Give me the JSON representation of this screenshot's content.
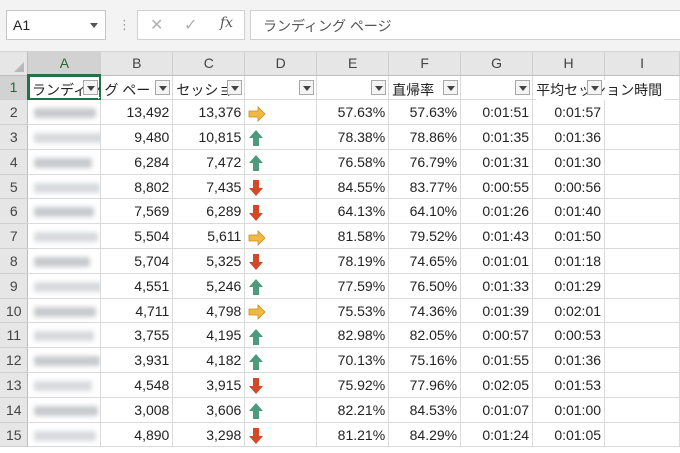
{
  "formula_bar": {
    "name_box": "A1",
    "formula": "ランディング ページ",
    "fx_label": "fx",
    "cancel_glyph": "✕",
    "enter_glyph": "✓"
  },
  "columns": [
    "A",
    "B",
    "C",
    "D",
    "E",
    "F",
    "G",
    "H",
    "I"
  ],
  "header_row": {
    "a": "ランディング ページ",
    "b": "グ ペー",
    "c": "セッショ",
    "d": "",
    "e": "",
    "f": "直帰率",
    "g": "",
    "h": "平均セッション時間"
  },
  "colors": {
    "accent": "#217346",
    "icon_up": "#4e9a7c",
    "icon_down": "#d2492a",
    "icon_side": "#f1b843"
  },
  "rows": [
    {
      "n": "2",
      "b": "13,492",
      "c": "13,376",
      "icon": "arrow-right-icon",
      "e": "57.63%",
      "f": "57.63%",
      "g": "0:01:51",
      "h": "0:01:57"
    },
    {
      "n": "3",
      "b": "9,480",
      "c": "10,815",
      "icon": "arrow-up-icon",
      "e": "78.38%",
      "f": "78.86%",
      "g": "0:01:35",
      "h": "0:01:36"
    },
    {
      "n": "4",
      "b": "6,284",
      "c": "7,472",
      "icon": "arrow-up-icon",
      "e": "76.58%",
      "f": "76.79%",
      "g": "0:01:31",
      "h": "0:01:30"
    },
    {
      "n": "5",
      "b": "8,802",
      "c": "7,435",
      "icon": "arrow-down-icon",
      "e": "84.55%",
      "f": "83.77%",
      "g": "0:00:55",
      "h": "0:00:56"
    },
    {
      "n": "6",
      "b": "7,569",
      "c": "6,289",
      "icon": "arrow-down-icon",
      "e": "64.13%",
      "f": "64.10%",
      "g": "0:01:26",
      "h": "0:01:40"
    },
    {
      "n": "7",
      "b": "5,504",
      "c": "5,611",
      "icon": "arrow-right-icon",
      "e": "81.58%",
      "f": "79.52%",
      "g": "0:01:43",
      "h": "0:01:50"
    },
    {
      "n": "8",
      "b": "5,704",
      "c": "5,325",
      "icon": "arrow-down-icon",
      "e": "78.19%",
      "f": "74.65%",
      "g": "0:01:01",
      "h": "0:01:18"
    },
    {
      "n": "9",
      "b": "4,551",
      "c": "5,246",
      "icon": "arrow-up-icon",
      "e": "77.59%",
      "f": "76.50%",
      "g": "0:01:33",
      "h": "0:01:29"
    },
    {
      "n": "10",
      "b": "4,711",
      "c": "4,798",
      "icon": "arrow-right-icon",
      "e": "75.53%",
      "f": "74.36%",
      "g": "0:01:39",
      "h": "0:02:01"
    },
    {
      "n": "11",
      "b": "3,755",
      "c": "4,195",
      "icon": "arrow-up-icon",
      "e": "82.98%",
      "f": "82.05%",
      "g": "0:00:57",
      "h": "0:00:53"
    },
    {
      "n": "12",
      "b": "3,931",
      "c": "4,182",
      "icon": "arrow-up-icon",
      "e": "70.13%",
      "f": "75.16%",
      "g": "0:01:55",
      "h": "0:01:36"
    },
    {
      "n": "13",
      "b": "4,548",
      "c": "3,915",
      "icon": "arrow-down-icon",
      "e": "75.92%",
      "f": "77.96%",
      "g": "0:02:05",
      "h": "0:01:53"
    },
    {
      "n": "14",
      "b": "3,008",
      "c": "3,606",
      "icon": "arrow-up-icon",
      "e": "82.21%",
      "f": "84.53%",
      "g": "0:01:07",
      "h": "0:01:00"
    },
    {
      "n": "15",
      "b": "4,890",
      "c": "3,298",
      "icon": "arrow-down-icon",
      "e": "81.21%",
      "f": "84.29%",
      "g": "0:01:24",
      "h": "0:01:05"
    }
  ]
}
